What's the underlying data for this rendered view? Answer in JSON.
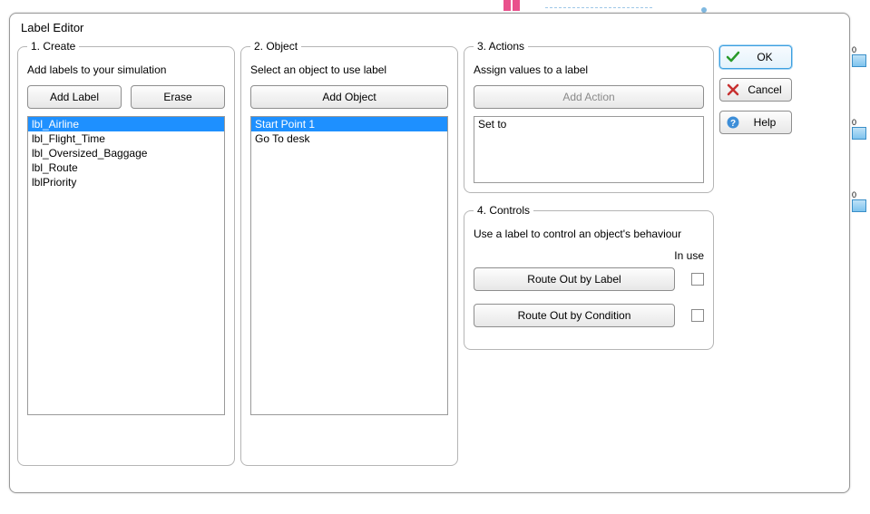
{
  "bg": {
    "badge0a": "0",
    "badge0b": "0",
    "badge0c": "0"
  },
  "dialog": {
    "title": "Label Editor"
  },
  "create": {
    "legend": "1. Create",
    "desc": "Add labels to your simulation",
    "addLabel": "Add Label",
    "erase": "Erase",
    "items": [
      {
        "label": "lbl_Airline",
        "selected": true
      },
      {
        "label": "lbl_Flight_Time",
        "selected": false
      },
      {
        "label": "lbl_Oversized_Baggage",
        "selected": false
      },
      {
        "label": "lbl_Route",
        "selected": false
      },
      {
        "label": "lblPriority",
        "selected": false
      }
    ]
  },
  "object": {
    "legend": "2. Object",
    "desc": "Select an object to use label",
    "addObject": "Add Object",
    "items": [
      {
        "label": "Start Point 1",
        "selected": true
      },
      {
        "label": "Go To desk",
        "selected": false
      }
    ]
  },
  "actions": {
    "legend": "3. Actions",
    "desc": "Assign values to a label",
    "addAction": "Add Action",
    "items": [
      {
        "label": "Set to",
        "selected": false
      }
    ]
  },
  "controls": {
    "legend": "4. Controls",
    "desc": "Use a label to control an object's behaviour",
    "inUseHead": "In use",
    "routeLabel": "Route Out by Label",
    "routeCond": "Route Out by Condition",
    "routeLabelChecked": false,
    "routeCondChecked": false
  },
  "buttons": {
    "ok": "OK",
    "cancel": "Cancel",
    "help": "Help"
  }
}
